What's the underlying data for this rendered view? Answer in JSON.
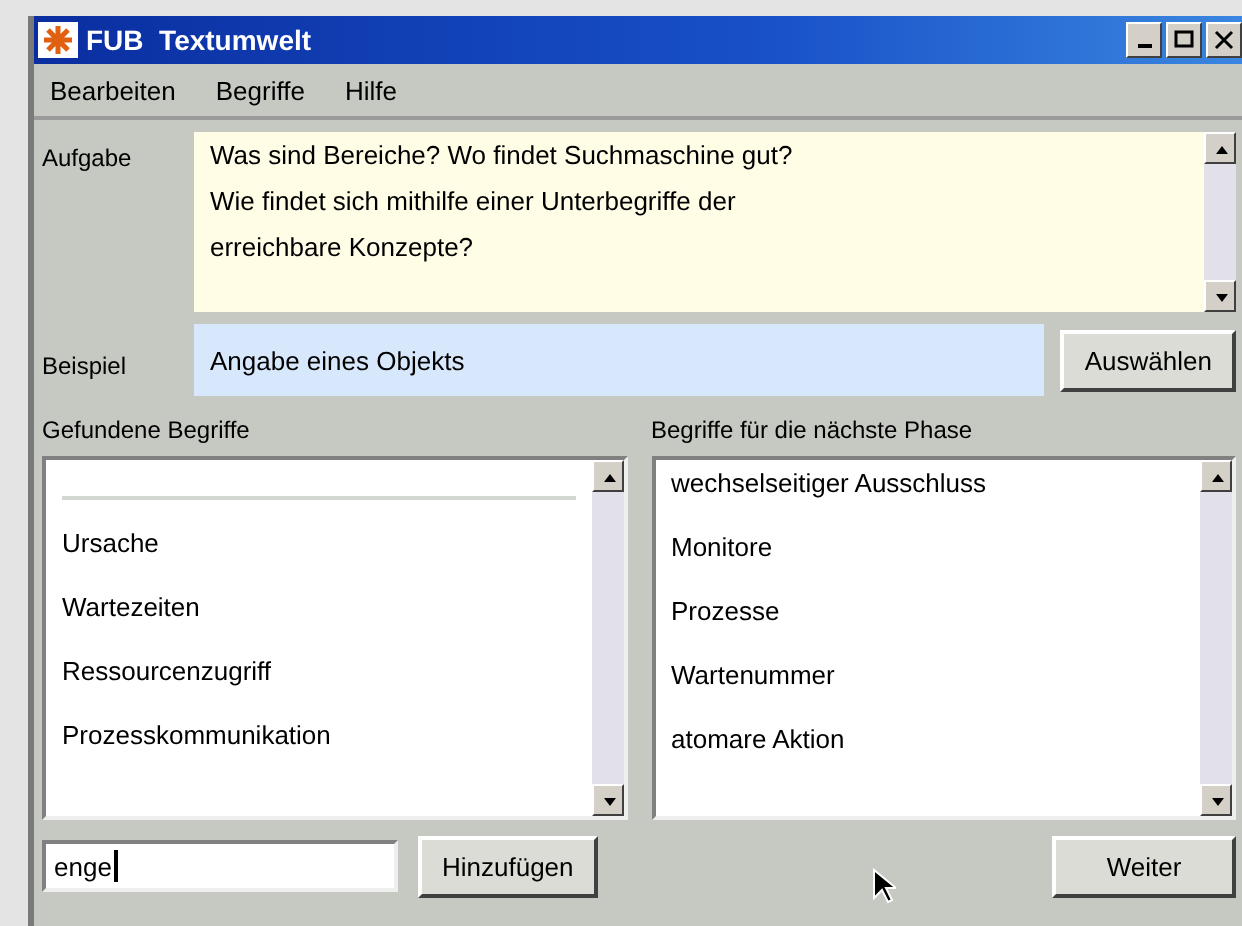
{
  "window": {
    "title": "FUB  Textumwelt"
  },
  "menu": [
    "Bearbeiten",
    "Begriffe",
    "Hilfe"
  ],
  "task": {
    "label": "Aufgabe",
    "lines": [
      "Was sind Bereiche? Wo findet Suchmaschine gut?",
      "Wie findet sich mithilfe einer Unterbegriffe der",
      "erreichbare Konzepte?"
    ]
  },
  "example": {
    "label": "Beispiel",
    "value": "Angabe eines Objekts",
    "button": "Auswählen"
  },
  "found": {
    "label": "Gefundene Begriffe",
    "items": [
      "Ursache",
      "Wartezeiten",
      "Ressourcenzugriff",
      "Prozesskommunikation"
    ],
    "input": "enge",
    "button": "Hinzufügen"
  },
  "next": {
    "label": "Begriffe für die nächste Phase",
    "items": [
      "wechselseitiger Ausschluss",
      "Monitore",
      "Prozesse",
      "Wartenummer",
      "atomare Aktion"
    ],
    "button": "Weiter"
  }
}
